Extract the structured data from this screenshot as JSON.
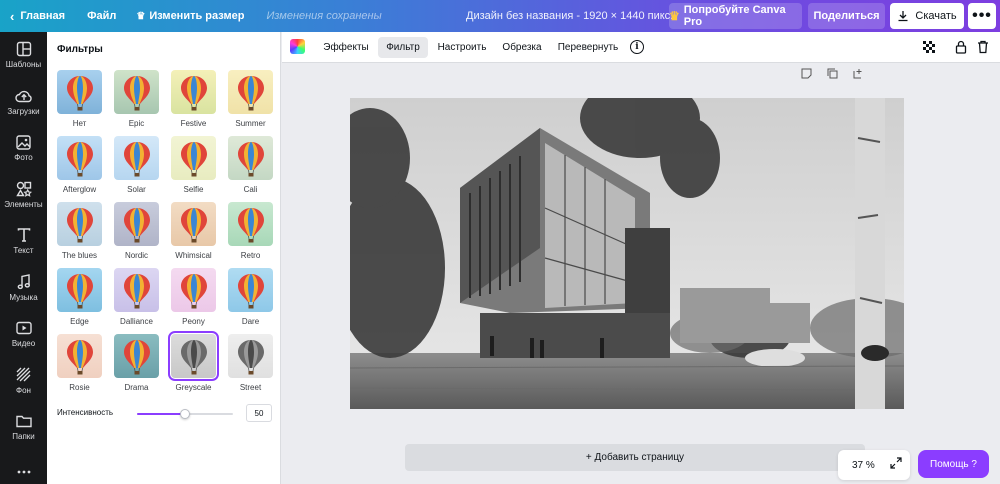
{
  "topbar": {
    "home": "Главная",
    "file": "Файл",
    "resize": "Изменить размер",
    "saved_status": "Изменения сохранены",
    "design_title": "Дизайн без названия - 1920 × 1440 пикс.",
    "try_pro": "Попробуйте Canva Pro",
    "share": "Поделиться",
    "download": "Скачать",
    "more": "•••"
  },
  "rail": [
    {
      "label": "Шаблоны",
      "icon": "templates-icon"
    },
    {
      "label": "Загрузки",
      "icon": "uploads-icon"
    },
    {
      "label": "Фото",
      "icon": "photos-icon"
    },
    {
      "label": "Элементы",
      "icon": "elements-icon"
    },
    {
      "label": "Текст",
      "icon": "text-icon"
    },
    {
      "label": "Музыка",
      "icon": "music-icon"
    },
    {
      "label": "Видео",
      "icon": "video-icon"
    },
    {
      "label": "Фон",
      "icon": "background-icon"
    },
    {
      "label": "Папки",
      "icon": "folders-icon"
    },
    {
      "label": "",
      "icon": "more-icon"
    }
  ],
  "panel": {
    "title": "Фильтры",
    "filters": [
      {
        "label": "Нет",
        "tint": "#7fb2d9",
        "top": "#a8d0ee",
        "sat": 1
      },
      {
        "label": "Epic",
        "tint": "#a7c6b0",
        "top": "#cfe3c9",
        "sat": 0.8
      },
      {
        "label": "Festive",
        "tint": "#d9e3a0",
        "top": "#f4f0b8",
        "sat": 1
      },
      {
        "label": "Summer",
        "tint": "#f0e2a8",
        "top": "#f8efc0",
        "sat": 1
      },
      {
        "label": "Afterglow",
        "tint": "#9ec6e8",
        "top": "#c3e0f6",
        "sat": 1
      },
      {
        "label": "Solar",
        "tint": "#b6d6f0",
        "top": "#d4e8f8",
        "sat": 1
      },
      {
        "label": "Selfie",
        "tint": "#e8ecc0",
        "top": "#f2f4d4",
        "sat": 0.9
      },
      {
        "label": "Cali",
        "tint": "#c4d8c4",
        "top": "#dfe9d8",
        "sat": 0.8
      },
      {
        "label": "The blues",
        "tint": "#b8d0e0",
        "top": "#cfe0ec",
        "sat": 0.7
      },
      {
        "label": "Nordic",
        "tint": "#b0b4c8",
        "top": "#c8ccdc",
        "sat": 0.6
      },
      {
        "label": "Whimsical",
        "tint": "#e8c8a8",
        "top": "#f2dcc4",
        "sat": 0.8
      },
      {
        "label": "Retro",
        "tint": "#a8d8b8",
        "top": "#c8e8d0",
        "sat": 0.8
      },
      {
        "label": "Edge",
        "tint": "#7ebfe0",
        "top": "#a4d6f0",
        "sat": 1
      },
      {
        "label": "Dalliance",
        "tint": "#c8c0e8",
        "top": "#dcd6f2",
        "sat": 0.8
      },
      {
        "label": "Peony",
        "tint": "#ecc8e8",
        "top": "#f4daf0",
        "sat": 0.9
      },
      {
        "label": "Dare",
        "tint": "#8ec8e8",
        "top": "#b0dcf2",
        "sat": 1
      },
      {
        "label": "Rosie",
        "tint": "#f0d0c0",
        "top": "#f6e0d4",
        "sat": 0.9
      },
      {
        "label": "Drama",
        "tint": "#6aa0a8",
        "top": "#8abcc0",
        "sat": 0.8
      },
      {
        "label": "Greyscale",
        "tint": "#c8c8c8",
        "top": "#dcdcdc",
        "sat": 0
      },
      {
        "label": "Street",
        "tint": "#e0e0e0",
        "top": "#eeeeee",
        "sat": 0
      }
    ],
    "selected": "Greyscale",
    "intensity_label": "Интенсивность",
    "intensity_value": "50"
  },
  "editor_toolbar": {
    "effects": "Эффекты",
    "filter": "Фильтр",
    "adjust": "Настроить",
    "crop": "Обрезка",
    "flip": "Перевернуть",
    "info": "i"
  },
  "canvas": {
    "add_page": "+ Добавить страницу",
    "zoom": "37 %",
    "help": "Помощь ?"
  }
}
